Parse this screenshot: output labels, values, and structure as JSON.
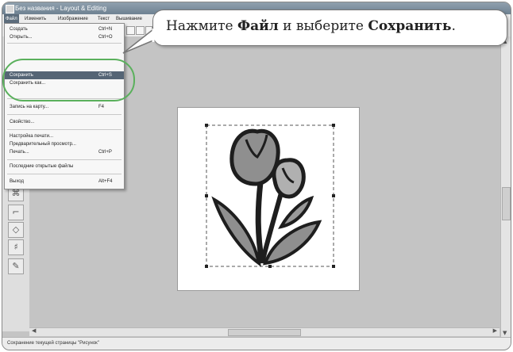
{
  "window": {
    "title": "Без названия - Layout & Editing"
  },
  "menubar": {
    "items": [
      "Файл",
      "Изменить",
      "Изображение",
      "Текст",
      "Вышивание"
    ]
  },
  "file_menu": {
    "items": [
      {
        "label": "Создать",
        "shortcut": "Ctrl+N"
      },
      {
        "label": "Открыть...",
        "shortcut": "Ctrl+O"
      },
      {
        "label": "",
        "shortcut": ""
      },
      {
        "label": "Сохранить",
        "shortcut": "Ctrl+S"
      },
      {
        "label": "Сохранить как...",
        "shortcut": ""
      },
      {
        "label": "Запись на карту...",
        "shortcut": "F4"
      },
      {
        "label": "Свойство...",
        "shortcut": ""
      },
      {
        "label": "Настройка печати...",
        "shortcut": ""
      },
      {
        "label": "Предварительный просмотр...",
        "shortcut": ""
      },
      {
        "label": "Печать...",
        "shortcut": "Ctrl+P"
      },
      {
        "label": "Последние открытые файлы",
        "shortcut": ""
      },
      {
        "label": "Выход",
        "shortcut": "Alt+F4"
      }
    ]
  },
  "callout": {
    "text_a": "Нажмите ",
    "bold_a": "Файл",
    "text_b": " и выберите ",
    "bold_b": "Сохранить",
    "text_c": "."
  },
  "statusbar": {
    "text": "Сохранение текущей страницы \"Рисунок\""
  },
  "colors": {
    "accent_ring": "#5ab05c",
    "menu_selected": "#556575",
    "titlebar": "#7a8b9a"
  }
}
